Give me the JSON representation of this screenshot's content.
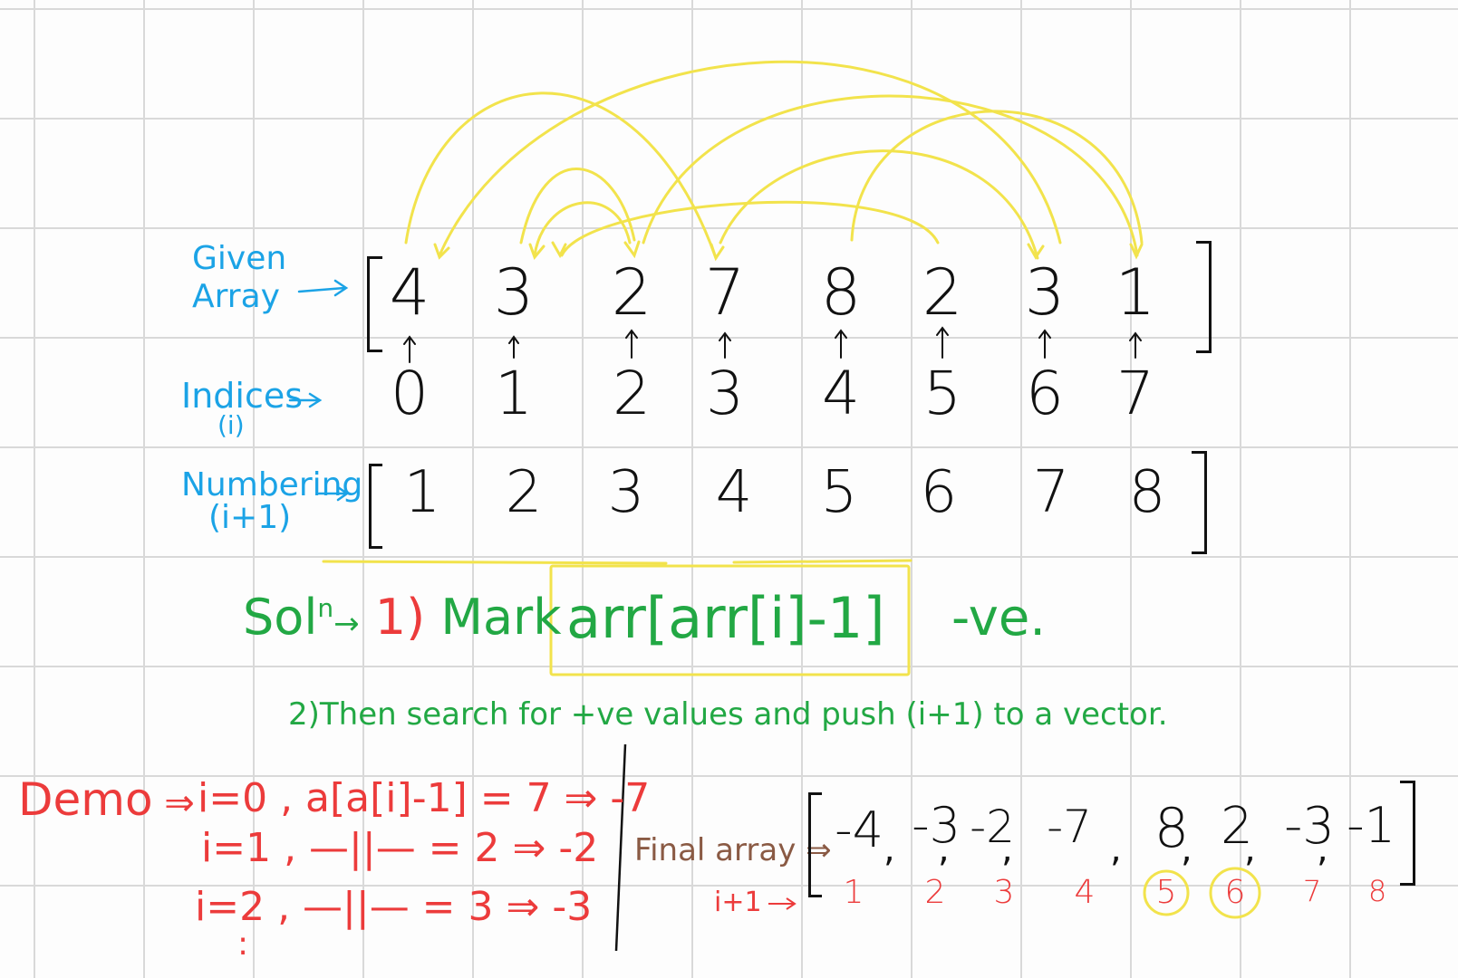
{
  "labels": {
    "given_line1": "Given",
    "given_line2": "Array",
    "indices_line1": "Indices",
    "indices_line2": "(i)",
    "numbering_line1": "Numbering",
    "numbering_line2": "(i+1)"
  },
  "given_array": [
    "4",
    "3",
    "2",
    "7",
    "8",
    "2",
    "3",
    "1"
  ],
  "indices": [
    "0",
    "1",
    "2",
    "3",
    "4",
    "5",
    "6",
    "7"
  ],
  "numbering": [
    "1",
    "2",
    "3",
    "4",
    "5",
    "6",
    "7",
    "8"
  ],
  "solution": {
    "prefix": "Sol",
    "superscript": "n",
    "step1_num": "1)",
    "step1_text": "Mark",
    "step1_expr": "arr[arr[i]-1]",
    "step1_suffix": "-ve.",
    "step2": "2)Then search for +ve values and push (i+1) to a vector."
  },
  "demo": {
    "label": "Demo",
    "lines": [
      "i=0 , a[a[i]-1] = 7 ⇒ -7",
      "i=1 , —||— = 2 ⇒ -2",
      "i=2 , —||— = 3 ⇒ -3",
      ":"
    ]
  },
  "final": {
    "label": "Final array",
    "values": [
      "-4",
      "-3",
      "-2",
      "-7",
      "8",
      "2",
      "-3",
      "-1"
    ],
    "index_label": "i+1",
    "indices": [
      "1",
      "2",
      "3",
      "4",
      "5",
      "6",
      "7",
      "8"
    ],
    "circled": [
      "5",
      "6"
    ]
  },
  "colors": {
    "arrows": "#f2e34c",
    "blue": "#1ba3e6",
    "green": "#22a844",
    "red": "#ec3b3b",
    "brown": "#8a5a44"
  }
}
